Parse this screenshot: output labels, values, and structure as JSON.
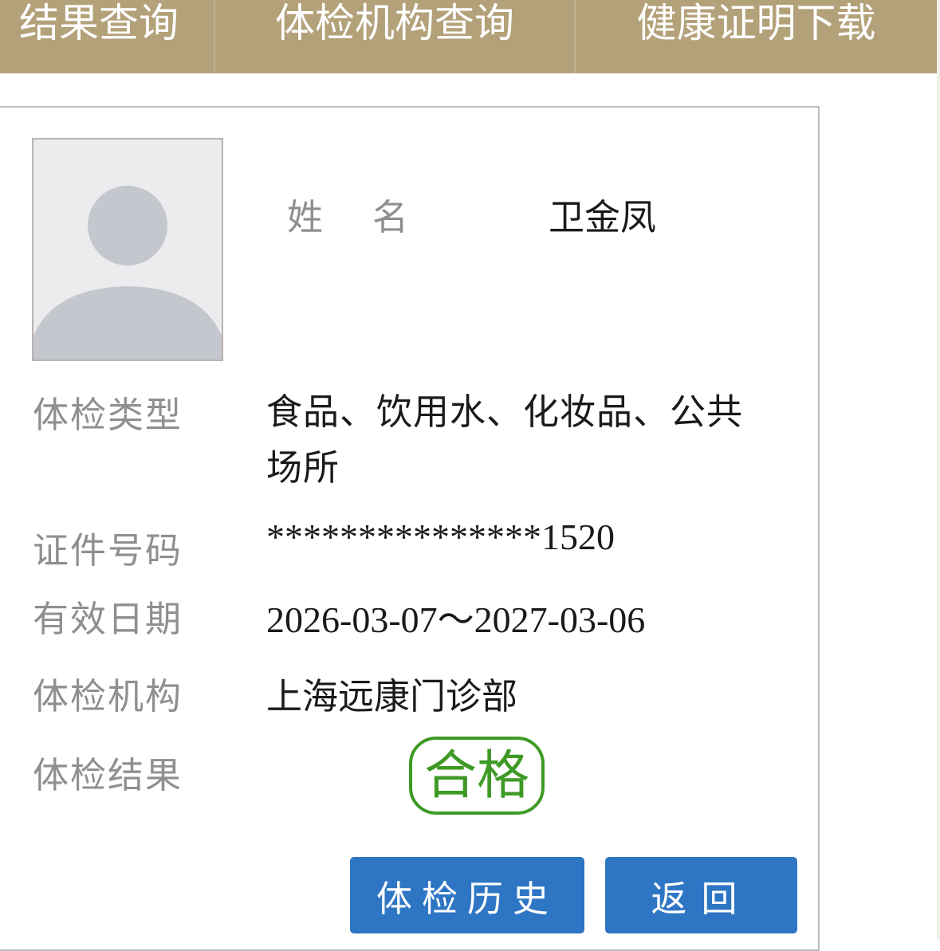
{
  "nav": {
    "tabs": [
      {
        "label": "结果查询"
      },
      {
        "label": "体检机构查询"
      },
      {
        "label": "健康证明下载"
      }
    ]
  },
  "record": {
    "name_label": "姓名",
    "name_value": "卫金凤",
    "fields": [
      {
        "label": "体检类型",
        "value": "食品、饮用水、化妆品、公共场所"
      },
      {
        "label": "证件号码",
        "value": "***************1520"
      },
      {
        "label": "有效日期",
        "value": "2026-03-07～2027-03-06"
      },
      {
        "label": "体检机构",
        "value": "上海远康门诊部"
      },
      {
        "label": "体检结果",
        "value": "合格"
      }
    ]
  },
  "actions": {
    "history_label": "体检历史",
    "back_label": "返回"
  },
  "colors": {
    "nav_background": "#b3a179",
    "button_blue": "#2e76c4",
    "stamp_green": "#3f9a25"
  }
}
